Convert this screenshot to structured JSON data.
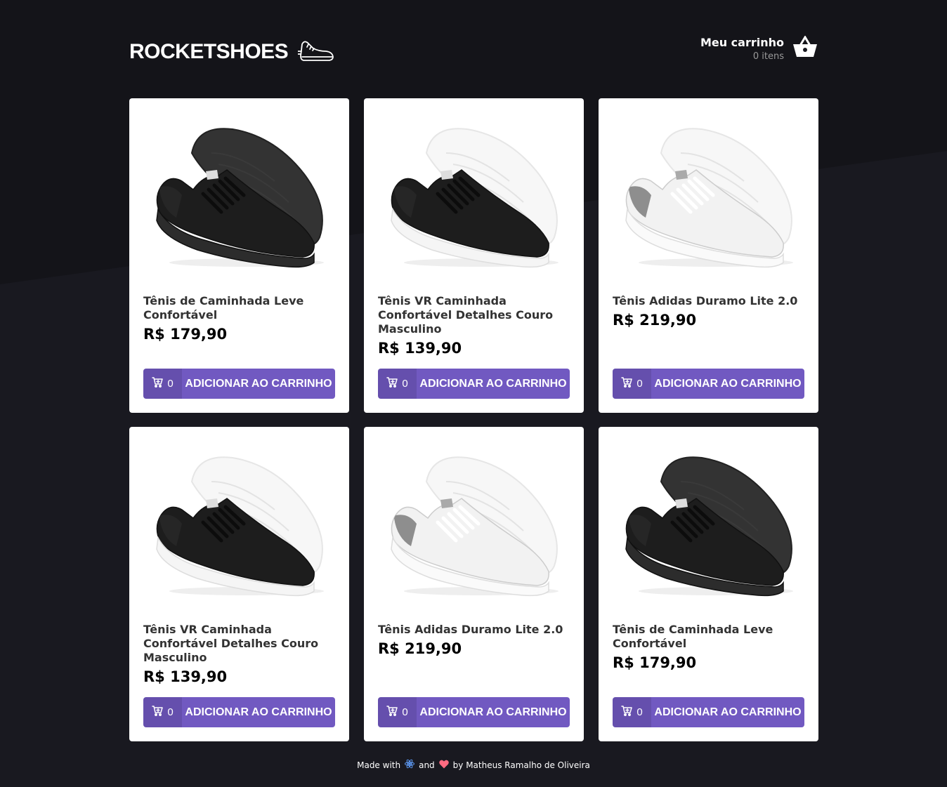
{
  "header": {
    "logo_text": "ROCKETSHOES",
    "cart_title": "Meu carrinho",
    "cart_count": "0 itens"
  },
  "products": [
    {
      "title": "Tênis de Caminhada Leve Confortável",
      "price": "R$ 179,90",
      "amount": "0",
      "button": "ADICIONAR AO CARRINHO",
      "variant": "black"
    },
    {
      "title": "Tênis VR Caminhada Confortável Detalhes Couro Masculino",
      "price": "R$ 139,90",
      "amount": "0",
      "button": "ADICIONAR AO CARRINHO",
      "variant": "black-white"
    },
    {
      "title": "Tênis Adidas Duramo Lite 2.0",
      "price": "R$ 219,90",
      "amount": "0",
      "button": "ADICIONAR AO CARRINHO",
      "variant": "white-grey"
    },
    {
      "title": "Tênis VR Caminhada Confortável Detalhes Couro Masculino",
      "price": "R$ 139,90",
      "amount": "0",
      "button": "ADICIONAR AO CARRINHO",
      "variant": "black-white"
    },
    {
      "title": "Tênis Adidas Duramo Lite 2.0",
      "price": "R$ 219,90",
      "amount": "0",
      "button": "ADICIONAR AO CARRINHO",
      "variant": "white-grey"
    },
    {
      "title": "Tênis de Caminhada Leve Confortável",
      "price": "R$ 179,90",
      "amount": "0",
      "button": "ADICIONAR AO CARRINHO",
      "variant": "black"
    }
  ],
  "footer": {
    "made_with": "Made with",
    "and": "and",
    "by": "by Matheus Ramalho de Oliveira"
  },
  "colors": {
    "background": "#191920",
    "accent": "#7159c1",
    "card": "#ffffff"
  }
}
